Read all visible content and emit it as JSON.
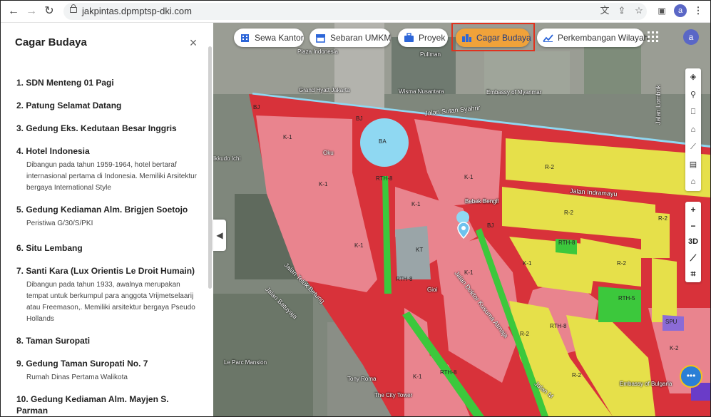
{
  "browser": {
    "url": "jakpintas.dpmptsp-dki.com",
    "avatar_letter": "a"
  },
  "sidebar": {
    "title": "Cagar Budaya",
    "close_label": "×",
    "items": [
      {
        "title": "1. SDN Menteng 01 Pagi",
        "desc": ""
      },
      {
        "title": "2. Patung Selamat Datang",
        "desc": ""
      },
      {
        "title": "3. Gedung Eks. Kedutaan Besar Inggris",
        "desc": ""
      },
      {
        "title": "4. Hotel Indonesia",
        "desc": "Dibangun pada tahun 1959-1964, hotel bertaraf internasional pertama di Indonesia. Memiliki Arsitektur bergaya International Style"
      },
      {
        "title": "5. Gedung Kediaman Alm. Brigjen Soetojo",
        "desc": "Peristiwa G/30/S/PKI"
      },
      {
        "title": "6. Situ Lembang",
        "desc": ""
      },
      {
        "title": "7. Santi Kara (Lux Orientis Le Droit Humain)",
        "desc": "Dibangun pada tahun 1933, awalnya merupakan tempat untuk berkumpul para anggota Vrijmetselaarij atau Freemason,. Memiliki arsitektur bergaya Pseudo Hollands"
      },
      {
        "title": "8. Taman Suropati",
        "desc": ""
      },
      {
        "title": "9. Gedung Taman Suropati No. 7",
        "desc": "Rumah Dinas Pertama Walikota"
      },
      {
        "title": "10. Gedung Kediaman Alm. Mayjen S. Parman",
        "desc": ""
      }
    ]
  },
  "tabs": [
    {
      "label": "Sewa Kantor",
      "icon": "office-building-icon"
    },
    {
      "label": "Sebaran UMKM",
      "icon": "shop-icon"
    },
    {
      "label": "Proyek",
      "icon": "briefcase-icon"
    },
    {
      "label": "Cagar Budaya",
      "icon": "heritage-building-icon",
      "active": true
    },
    {
      "label": "Perkembangan Wilayah",
      "icon": "trend-chart-icon"
    }
  ],
  "map": {
    "avatar_letter": "a",
    "zoom_in": "+",
    "zoom_out": "−",
    "view_3d": "3D",
    "places": {
      "plaza_indonesia": "Plaza Indonesia",
      "grand_hyatt": "Grand Hyatt Jakarta",
      "wisma_nusantara": "Wisma Nusantara",
      "embassy_myanmar": "Embassy of Myanmar",
      "pullman": "Pullman",
      "oku": "Oku",
      "bebek_bengil": "Bebek Bengil",
      "gioi": "Gioi",
      "le_parc": "Le Parc Mansion",
      "tony_roma": "Tony Roma",
      "city_tower": "The City Tower",
      "embassy_bulgaria": "Embassy of Bulgaria",
      "ikkudo": "Ikkudo Ichi"
    },
    "streets": {
      "sutan_syahrir": "Jalan Sutan Syahrir",
      "indramayu": "Jalan Indramayu",
      "teluk_betung": "Jalan Teluk Betung",
      "batuyaja": "Jalan Batuyaja",
      "kusuma_atmaja": "Jalan Doktor Kusuma Atmaja",
      "lombok": "Jalan Lombok",
      "jalan_m": "Jalan M"
    },
    "zones": {
      "k1": "K-1",
      "r2": "R-2",
      "bj": "BJ",
      "ba": "BA",
      "rth8": "RTH-8",
      "rth5": "RTH-5",
      "kt": "KT",
      "k2": "K-2",
      "spu": "SPU"
    }
  },
  "colors": {
    "active_tab": "#f0a23a",
    "highlight_border": "#e0321e",
    "zone_commercial": "#e9848e",
    "zone_road": "#d8323a",
    "zone_residential": "#e6e04a",
    "zone_green": "#3cc83c",
    "zone_water": "#8fd8f2",
    "avatar": "#5a67c6"
  }
}
